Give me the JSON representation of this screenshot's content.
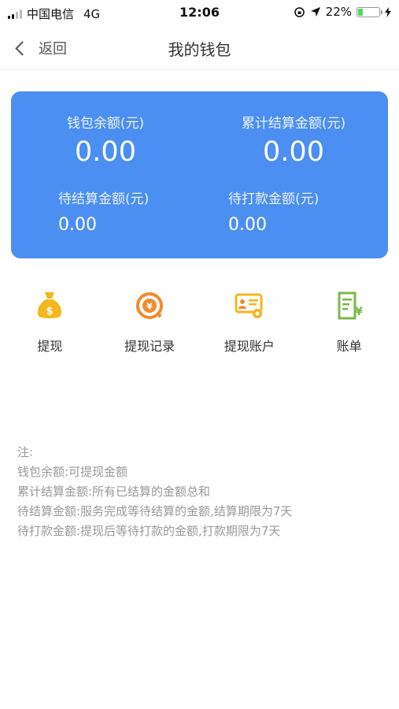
{
  "status_bar": {
    "carrier": "中国电信",
    "network": "4G",
    "time": "12:06",
    "battery_percent": "22%",
    "battery_level": 0.22
  },
  "nav": {
    "back_label": "返回",
    "title": "我的钱包"
  },
  "summary": {
    "balance_label": "钱包余额(元)",
    "balance_value": "0.00",
    "total_settled_label": "累计结算金额(元)",
    "total_settled_value": "0.00",
    "pending_settlement_label": "待结算金额(元)",
    "pending_settlement_value": "0.00",
    "pending_payment_label": "待打款金额(元)",
    "pending_payment_value": "0.00"
  },
  "actions": [
    {
      "label": "提现",
      "icon": "money-bag-icon"
    },
    {
      "label": "提现记录",
      "icon": "yuan-record-icon"
    },
    {
      "label": "提现账户",
      "icon": "account-settings-icon"
    },
    {
      "label": "账单",
      "icon": "bill-icon"
    }
  ],
  "notes": {
    "heading": "注:",
    "lines": [
      "钱包余额:可提现金额",
      "累计结算金额:所有已结算的金额总和",
      "待结算金额:服务完成等待结算的金额,结算期限为7天",
      "待打款金额:提现后等待打款的金额,打款期限为7天"
    ]
  },
  "colors": {
    "card_bg": "#4b8ff2",
    "withdraw_icon": "#f5b61e",
    "record_icon": "#f08a2c",
    "account_icon": "#f5b61e",
    "bill_icon": "#79b84a"
  }
}
